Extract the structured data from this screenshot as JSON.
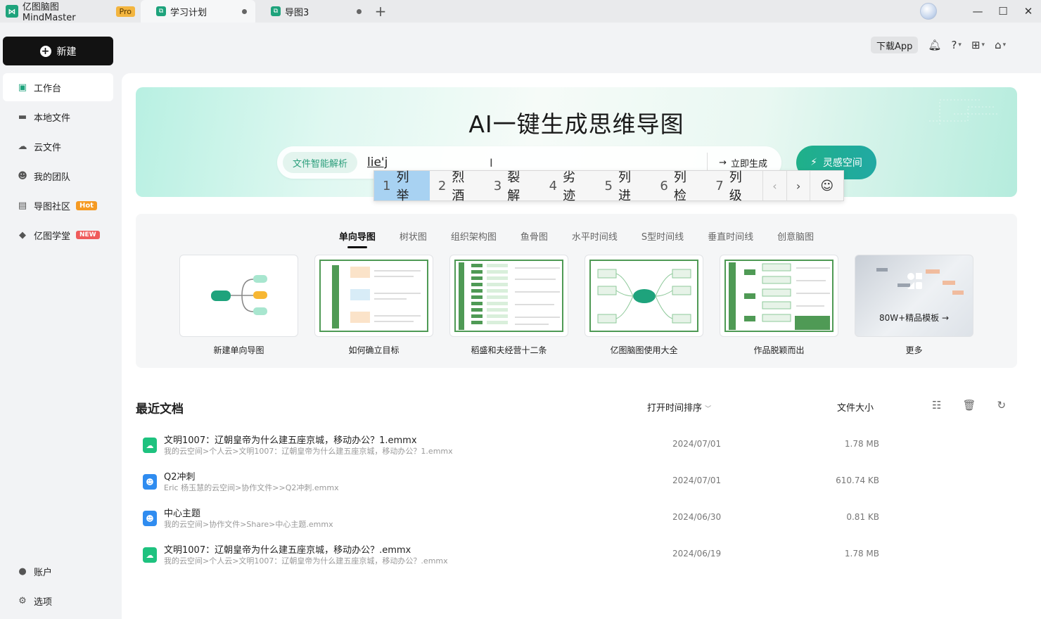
{
  "titlebar": {
    "app_name": "亿图脑图MindMaster",
    "pro_badge": "Pro",
    "tabs": [
      {
        "label": "学习计划"
      },
      {
        "label": "导图3"
      }
    ]
  },
  "sidebar": {
    "new_label": "新建",
    "items": [
      {
        "label": "工作台",
        "icon": "workbench-icon"
      },
      {
        "label": "本地文件",
        "icon": "folder-icon"
      },
      {
        "label": "云文件",
        "icon": "cloud-icon"
      },
      {
        "label": "我的团队",
        "icon": "team-icon"
      },
      {
        "label": "导图社区",
        "icon": "community-icon",
        "badge": "Hot"
      },
      {
        "label": "亿图学堂",
        "icon": "academy-icon",
        "badge": "NEW"
      }
    ],
    "bottom": [
      {
        "label": "账户",
        "icon": "account-icon"
      },
      {
        "label": "选项",
        "icon": "gear-icon"
      }
    ]
  },
  "toolbar": {
    "download_app": "下载App"
  },
  "ai": {
    "title": "AI一键生成思维导图",
    "parse_chip": "文件智能解析",
    "input_value": "lie'j",
    "generate_label": "立即生成",
    "inspire_label": "灵感空间"
  },
  "ime": {
    "candidates": [
      {
        "n": "1",
        "text": "列举"
      },
      {
        "n": "2",
        "text": "烈酒"
      },
      {
        "n": "3",
        "text": "裂解"
      },
      {
        "n": "4",
        "text": "劣迹"
      },
      {
        "n": "5",
        "text": "列进"
      },
      {
        "n": "6",
        "text": "列检"
      },
      {
        "n": "7",
        "text": "列级"
      }
    ]
  },
  "templates": {
    "tabs": [
      "单向导图",
      "树状图",
      "组织架构图",
      "鱼骨图",
      "水平时间线",
      "S型时间线",
      "垂直时间线",
      "创意脑图"
    ],
    "cards": [
      {
        "label": "新建单向导图"
      },
      {
        "label": "如何确立目标"
      },
      {
        "label": "稻盛和夫经营十二条"
      },
      {
        "label": "亿图脑图使用大全"
      },
      {
        "label": "作品脱颖而出"
      },
      {
        "label": "更多"
      }
    ],
    "more_overlay": "80W+精品模板"
  },
  "recent": {
    "title": "最近文档",
    "sort_label": "打开时间排序",
    "size_label": "文件大小",
    "rows": [
      {
        "name": "文明1007：辽朝皇帝为什么建五座京城，移动办公？1.emmx",
        "path": "我的云空间>个人云>文明1007：辽朝皇帝为什么建五座京城，移动办公？1.emmx",
        "date": "2024/07/01",
        "size": "1.78 MB",
        "type": "cloud"
      },
      {
        "name": "Q2冲刺",
        "path": "Eric 杨玉慧的云空间>协作文件>>Q2冲刺.emmx",
        "date": "2024/07/01",
        "size": "610.74 KB",
        "type": "team"
      },
      {
        "name": "中心主题",
        "path": "我的云空间>协作文件>Share>中心主题.emmx",
        "date": "2024/06/30",
        "size": "0.81 KB",
        "type": "team"
      },
      {
        "name": "文明1007：辽朝皇帝为什么建五座京城，移动办公？.emmx",
        "path": "我的云空间>个人云>文明1007：辽朝皇帝为什么建五座京城，移动办公？.emmx",
        "date": "2024/06/19",
        "size": "1.78 MB",
        "type": "cloud"
      }
    ]
  },
  "colors": {
    "accent": "#1ea37c",
    "pro": "#f3b53f",
    "hot": "#f59a23",
    "new": "#ef5b5b",
    "ime_selected": "#a8d2f2"
  }
}
